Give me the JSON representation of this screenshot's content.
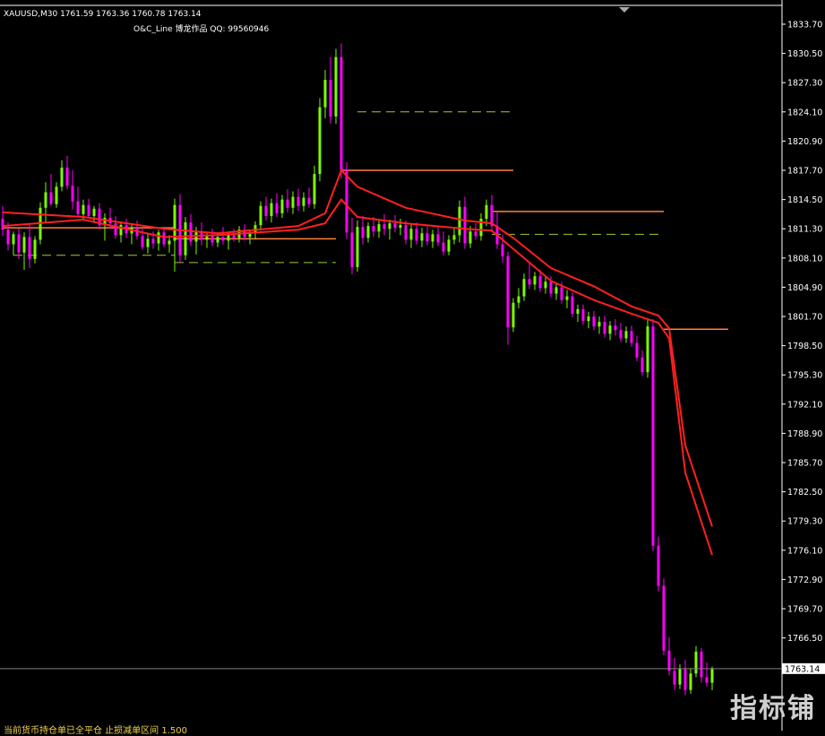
{
  "header": {
    "symbol_line": "XAUUSD,M30  1761.59 1763.36 1760.78 1763.14",
    "indicator_line": "O&C_Line   博龙作品  QQ: 99560946"
  },
  "footer_text": "当前货币持仓单已全平仓    止损减单区间    1.500",
  "watermark": "指标铺",
  "colors": {
    "background": "#000000",
    "bull": "#7CFC00",
    "bear": "#FF00FF",
    "ma": "#FF2020",
    "level": "#FF8040",
    "level_dash": "#9ACD32",
    "axis": "#FFFFFF",
    "price_line": "#808080"
  },
  "chart_data": {
    "type": "candlestick",
    "symbol": "XAUUSD",
    "timeframe": "M30",
    "ohlc_last": {
      "open": 1761.59,
      "high": 1763.36,
      "low": 1760.78,
      "close": 1763.14
    },
    "current_price_label": "1763.14",
    "y_ticks": [
      "1833.70",
      "1830.50",
      "1827.30",
      "1824.10",
      "1820.90",
      "1817.70",
      "1814.50",
      "1811.30",
      "1808.10",
      "1804.90",
      "1801.70",
      "1798.50",
      "1795.30",
      "1792.10",
      "1788.90",
      "1785.70",
      "1782.50",
      "1779.30",
      "1776.10",
      "1772.90",
      "1769.70",
      "1766.50"
    ],
    "ylim": [
      1760.0,
      1835.0
    ],
    "candles": [
      [
        1812.4,
        1813.8,
        1810.5,
        1811.2
      ],
      [
        1811.2,
        1812.0,
        1808.9,
        1809.6
      ],
      [
        1809.6,
        1811.0,
        1808.4,
        1810.7
      ],
      [
        1810.7,
        1811.3,
        1808.0,
        1808.7
      ],
      [
        1808.7,
        1810.9,
        1806.8,
        1810.4
      ],
      [
        1810.4,
        1811.9,
        1807.0,
        1808.0
      ],
      [
        1808.0,
        1810.5,
        1807.5,
        1810.1
      ],
      [
        1810.1,
        1814.2,
        1809.6,
        1813.6
      ],
      [
        1813.6,
        1816.4,
        1812.0,
        1815.3
      ],
      [
        1815.3,
        1817.3,
        1813.8,
        1814.0
      ],
      [
        1814.0,
        1816.4,
        1813.6,
        1815.9
      ],
      [
        1815.9,
        1818.8,
        1815.4,
        1818.0
      ],
      [
        1818.0,
        1819.3,
        1815.6,
        1816.0
      ],
      [
        1816.0,
        1817.7,
        1813.4,
        1814.3
      ],
      [
        1814.3,
        1815.9,
        1812.6,
        1812.9
      ],
      [
        1812.9,
        1814.5,
        1812.2,
        1813.9
      ],
      [
        1813.9,
        1814.6,
        1812.4,
        1812.7
      ],
      [
        1812.7,
        1813.8,
        1812.1,
        1813.5
      ],
      [
        1813.5,
        1814.1,
        1811.2,
        1811.7
      ],
      [
        1811.7,
        1813.0,
        1810.0,
        1812.5
      ],
      [
        1812.5,
        1813.6,
        1811.3,
        1811.9
      ],
      [
        1811.9,
        1812.7,
        1810.2,
        1810.6
      ],
      [
        1810.6,
        1812.1,
        1809.8,
        1811.7
      ],
      [
        1811.7,
        1812.4,
        1810.3,
        1810.8
      ],
      [
        1810.8,
        1811.9,
        1809.6,
        1811.4
      ],
      [
        1811.4,
        1812.2,
        1810.1,
        1810.5
      ],
      [
        1810.5,
        1811.3,
        1809.0,
        1809.3
      ],
      [
        1809.3,
        1810.7,
        1808.6,
        1810.2
      ],
      [
        1810.2,
        1811.0,
        1809.1,
        1809.7
      ],
      [
        1809.7,
        1811.2,
        1808.9,
        1810.9
      ],
      [
        1810.9,
        1811.4,
        1809.3,
        1809.6
      ],
      [
        1809.6,
        1810.6,
        1808.7,
        1810.0
      ],
      [
        1810.0,
        1814.6,
        1806.6,
        1813.9
      ],
      [
        1813.9,
        1815.1,
        1807.6,
        1808.4
      ],
      [
        1808.4,
        1812.6,
        1807.9,
        1812.0
      ],
      [
        1812.0,
        1812.9,
        1809.4,
        1809.9
      ],
      [
        1809.9,
        1811.5,
        1808.5,
        1811.0
      ],
      [
        1811.0,
        1812.0,
        1809.5,
        1810.1
      ],
      [
        1810.1,
        1810.9,
        1809.2,
        1810.6
      ],
      [
        1810.6,
        1811.3,
        1809.4,
        1809.8
      ],
      [
        1809.8,
        1810.9,
        1809.3,
        1810.4
      ],
      [
        1810.4,
        1811.5,
        1809.6,
        1810.0
      ],
      [
        1810.0,
        1810.9,
        1809.0,
        1810.6
      ],
      [
        1810.6,
        1811.3,
        1809.9,
        1810.3
      ],
      [
        1810.3,
        1811.6,
        1809.8,
        1811.2
      ],
      [
        1811.2,
        1811.8,
        1810.0,
        1810.4
      ],
      [
        1810.4,
        1811.2,
        1809.6,
        1810.9
      ],
      [
        1810.9,
        1812.1,
        1810.2,
        1811.7
      ],
      [
        1811.7,
        1814.3,
        1811.1,
        1813.8
      ],
      [
        1813.8,
        1814.8,
        1812.2,
        1812.7
      ],
      [
        1812.7,
        1814.6,
        1812.0,
        1814.1
      ],
      [
        1814.1,
        1815.2,
        1812.6,
        1813.0
      ],
      [
        1813.0,
        1815.0,
        1812.5,
        1814.5
      ],
      [
        1814.5,
        1815.6,
        1813.1,
        1813.6
      ],
      [
        1813.6,
        1815.4,
        1812.9,
        1814.8
      ],
      [
        1814.8,
        1815.7,
        1813.3,
        1813.8
      ],
      [
        1813.8,
        1815.3,
        1813.2,
        1814.7
      ],
      [
        1814.7,
        1815.8,
        1813.6,
        1814.0
      ],
      [
        1814.0,
        1818.2,
        1813.5,
        1817.3
      ],
      [
        1817.3,
        1825.6,
        1816.5,
        1824.6
      ],
      [
        1824.6,
        1828.7,
        1823.4,
        1827.6
      ],
      [
        1827.6,
        1830.1,
        1822.8,
        1823.6
      ],
      [
        1823.6,
        1831.0,
        1822.8,
        1830.1
      ],
      [
        1830.1,
        1831.6,
        1816.8,
        1817.7
      ],
      [
        1817.7,
        1818.6,
        1810.2,
        1810.9
      ],
      [
        1810.9,
        1812.5,
        1806.3,
        1807.1
      ],
      [
        1807.1,
        1812.2,
        1806.6,
        1811.5
      ],
      [
        1811.5,
        1812.7,
        1809.6,
        1810.3
      ],
      [
        1810.3,
        1812.0,
        1809.8,
        1811.6
      ],
      [
        1811.6,
        1812.6,
        1810.4,
        1811.0
      ],
      [
        1811.0,
        1812.2,
        1810.3,
        1811.8
      ],
      [
        1811.8,
        1812.9,
        1810.6,
        1811.3
      ],
      [
        1811.3,
        1812.3,
        1810.1,
        1811.9
      ],
      [
        1811.9,
        1812.8,
        1810.9,
        1811.4
      ],
      [
        1811.4,
        1812.4,
        1810.6,
        1811.7
      ],
      [
        1811.7,
        1812.2,
        1809.6,
        1810.1
      ],
      [
        1810.1,
        1811.8,
        1809.2,
        1811.3
      ],
      [
        1811.3,
        1812.0,
        1809.6,
        1810.0
      ],
      [
        1810.0,
        1811.4,
        1809.3,
        1810.8
      ],
      [
        1810.8,
        1811.6,
        1809.5,
        1809.9
      ],
      [
        1809.9,
        1811.2,
        1809.2,
        1810.7
      ],
      [
        1810.7,
        1811.5,
        1809.4,
        1809.8
      ],
      [
        1809.8,
        1811.0,
        1808.4,
        1808.8
      ],
      [
        1808.8,
        1810.6,
        1808.4,
        1810.1
      ],
      [
        1810.1,
        1811.4,
        1809.6,
        1810.6
      ],
      [
        1810.6,
        1814.4,
        1809.8,
        1813.7
      ],
      [
        1813.7,
        1814.8,
        1809.1,
        1809.7
      ],
      [
        1809.7,
        1811.6,
        1809.2,
        1811.0
      ],
      [
        1811.0,
        1811.9,
        1810.1,
        1810.5
      ],
      [
        1810.5,
        1813.0,
        1810.0,
        1812.4
      ],
      [
        1812.4,
        1814.5,
        1811.6,
        1813.9
      ],
      [
        1813.9,
        1815.0,
        1810.9,
        1811.6
      ],
      [
        1811.6,
        1813.1,
        1809.1,
        1809.6
      ],
      [
        1809.6,
        1810.7,
        1807.6,
        1808.3
      ],
      [
        1808.3,
        1808.8,
        1798.6,
        1800.5
      ],
      [
        1800.5,
        1803.7,
        1800.0,
        1803.2
      ],
      [
        1803.2,
        1804.8,
        1802.6,
        1803.9
      ],
      [
        1803.9,
        1806.4,
        1803.4,
        1805.8
      ],
      [
        1805.8,
        1807.5,
        1804.7,
        1805.2
      ],
      [
        1805.2,
        1806.6,
        1804.6,
        1806.1
      ],
      [
        1806.1,
        1806.8,
        1804.4,
        1804.8
      ],
      [
        1804.8,
        1806.0,
        1804.2,
        1805.5
      ],
      [
        1805.5,
        1806.1,
        1803.8,
        1804.2
      ],
      [
        1804.2,
        1805.3,
        1803.5,
        1804.9
      ],
      [
        1804.9,
        1805.5,
        1803.1,
        1803.5
      ],
      [
        1803.5,
        1804.6,
        1802.6,
        1803.9
      ],
      [
        1803.9,
        1804.3,
        1801.6,
        1802.0
      ],
      [
        1802.0,
        1803.0,
        1801.1,
        1802.5
      ],
      [
        1802.5,
        1803.0,
        1800.8,
        1801.2
      ],
      [
        1801.2,
        1802.2,
        1800.4,
        1801.7
      ],
      [
        1801.7,
        1802.3,
        1800.2,
        1800.6
      ],
      [
        1800.6,
        1801.7,
        1799.8,
        1801.1
      ],
      [
        1801.1,
        1801.8,
        1799.4,
        1799.8
      ],
      [
        1799.8,
        1801.2,
        1799.1,
        1800.7
      ],
      [
        1800.7,
        1801.4,
        1799.6,
        1800.2
      ],
      [
        1800.2,
        1801.0,
        1798.9,
        1799.3
      ],
      [
        1799.3,
        1800.6,
        1798.8,
        1800.1
      ],
      [
        1800.1,
        1800.7,
        1798.4,
        1798.8
      ],
      [
        1798.8,
        1799.6,
        1796.8,
        1797.2
      ],
      [
        1797.2,
        1798.0,
        1795.2,
        1795.6
      ],
      [
        1795.6,
        1801.4,
        1795.0,
        1800.6
      ],
      [
        1800.6,
        1801.4,
        1776.0,
        1776.6
      ],
      [
        1776.6,
        1777.6,
        1771.6,
        1772.2
      ],
      [
        1772.2,
        1773.0,
        1764.6,
        1765.1
      ],
      [
        1765.1,
        1766.6,
        1762.4,
        1762.9
      ],
      [
        1762.9,
        1764.3,
        1760.8,
        1761.4
      ],
      [
        1761.4,
        1763.6,
        1760.9,
        1763.1
      ],
      [
        1763.1,
        1764.1,
        1760.2,
        1760.8
      ],
      [
        1760.8,
        1763.2,
        1760.4,
        1762.6
      ],
      [
        1762.6,
        1765.6,
        1762.2,
        1765.0
      ],
      [
        1765.0,
        1765.4,
        1761.6,
        1762.2
      ],
      [
        1762.2,
        1763.8,
        1761.2,
        1761.6
      ],
      [
        1761.59,
        1763.36,
        1760.78,
        1763.14
      ]
    ],
    "lines": [
      {
        "name": "ma-fast",
        "points": [
          [
            0,
            1813.1
          ],
          [
            15,
            1812.6
          ],
          [
            30,
            1811.3
          ],
          [
            40,
            1810.8
          ],
          [
            55,
            1811.6
          ],
          [
            60,
            1813.0
          ],
          [
            63,
            1817.7
          ],
          [
            66,
            1815.9
          ],
          [
            75,
            1813.6
          ],
          [
            86,
            1812.2
          ],
          [
            91,
            1811.9
          ],
          [
            95,
            1810.3
          ],
          [
            102,
            1807.0
          ],
          [
            110,
            1805.0
          ],
          [
            117,
            1802.8
          ],
          [
            122,
            1801.8
          ],
          [
            124,
            1800.4
          ],
          [
            127,
            1787.6
          ],
          [
            132,
            1778.7
          ]
        ]
      },
      {
        "name": "ma-slow",
        "points": [
          [
            0,
            1811.6
          ],
          [
            15,
            1812.3
          ],
          [
            30,
            1810.4
          ],
          [
            40,
            1810.6
          ],
          [
            55,
            1811.2
          ],
          [
            60,
            1811.9
          ],
          [
            63,
            1814.5
          ],
          [
            66,
            1812.6
          ],
          [
            75,
            1811.9
          ],
          [
            86,
            1811.3
          ],
          [
            91,
            1811.1
          ],
          [
            95,
            1809.1
          ],
          [
            102,
            1805.6
          ],
          [
            110,
            1803.5
          ],
          [
            117,
            1802.0
          ],
          [
            122,
            1801.0
          ],
          [
            124,
            1799.3
          ],
          [
            127,
            1784.6
          ],
          [
            132,
            1775.6
          ]
        ]
      }
    ],
    "levels": [
      {
        "price": 1817.7,
        "x_start": 63,
        "x_end": 95,
        "style": "solid"
      },
      {
        "price": 1824.1,
        "x_start": 66,
        "x_end": 95,
        "style": "dash"
      },
      {
        "price": 1813.2,
        "x_start": 91,
        "x_end": 123,
        "style": "solid"
      },
      {
        "price": 1810.7,
        "x_start": 91,
        "x_end": 123,
        "style": "dash"
      },
      {
        "price": 1811.4,
        "x_start": 0,
        "x_end": 32,
        "style": "solid"
      },
      {
        "price": 1808.4,
        "x_start": 2,
        "x_end": 32,
        "style": "dash"
      },
      {
        "price": 1810.2,
        "x_start": 32,
        "x_end": 62,
        "style": "solid"
      },
      {
        "price": 1807.6,
        "x_start": 32,
        "x_end": 62,
        "style": "dash"
      },
      {
        "price": 1800.3,
        "x_start": 123,
        "x_end": 135,
        "style": "solid"
      }
    ]
  }
}
